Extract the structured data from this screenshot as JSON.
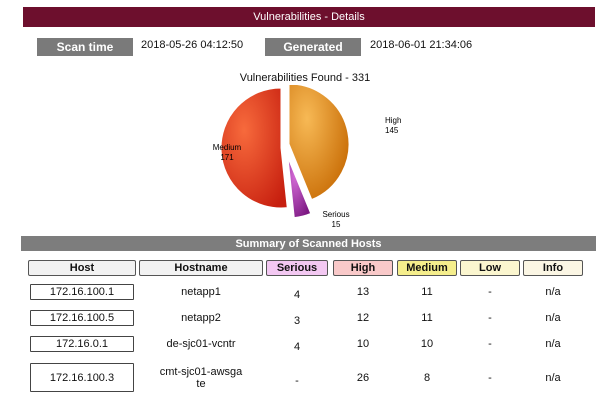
{
  "page": {
    "title": "Vulnerabilities  - Details",
    "scan_time_label": "Scan time",
    "scan_time_value": "2018-05-26 04:12:50",
    "generated_label": "Generated",
    "generated_value": "2018-06-01 21:34:06"
  },
  "chart_data": {
    "type": "pie",
    "title": "Vulnerabilities Found - 331",
    "slices": [
      {
        "label": "High",
        "value": 145,
        "color": "#e08a10"
      },
      {
        "label": "Serious",
        "value": 15,
        "color": "#9b2ca0"
      },
      {
        "label": "Medium",
        "value": 171,
        "color": "#e03418"
      }
    ]
  },
  "summary": {
    "title": "Summary of Scanned Hosts",
    "columns": [
      {
        "label": "Host",
        "bg": "#f2f2f2"
      },
      {
        "label": "Hostname",
        "bg": "#f2f2f2"
      },
      {
        "label": "Serious",
        "bg": "#f3c8f2"
      },
      {
        "label": "High",
        "bg": "#f9c9c9"
      },
      {
        "label": "Medium",
        "bg": "#f5ee8c"
      },
      {
        "label": "Low",
        "bg": "#fbf6cf"
      },
      {
        "label": "Info",
        "bg": "#fbf6e4"
      }
    ],
    "rows": [
      {
        "host": "172.16.100.1",
        "hostname": "netapp1",
        "serious": "4",
        "high": "13",
        "medium": "11",
        "low": "-",
        "info": "n/a"
      },
      {
        "host": "172.16.100.5",
        "hostname": "netapp2",
        "serious": "3",
        "high": "12",
        "medium": "11",
        "low": "-",
        "info": "n/a"
      },
      {
        "host": "172.16.0.1",
        "hostname": "de-sjc01-vcntr",
        "serious": "4",
        "high": "10",
        "medium": "10",
        "low": "-",
        "info": "n/a"
      },
      {
        "host": "172.16.100.3",
        "hostname": "cmt-sjc01-awsga\nte",
        "serious": "-",
        "high": "26",
        "medium": "8",
        "low": "-",
        "info": "n/a"
      }
    ]
  }
}
